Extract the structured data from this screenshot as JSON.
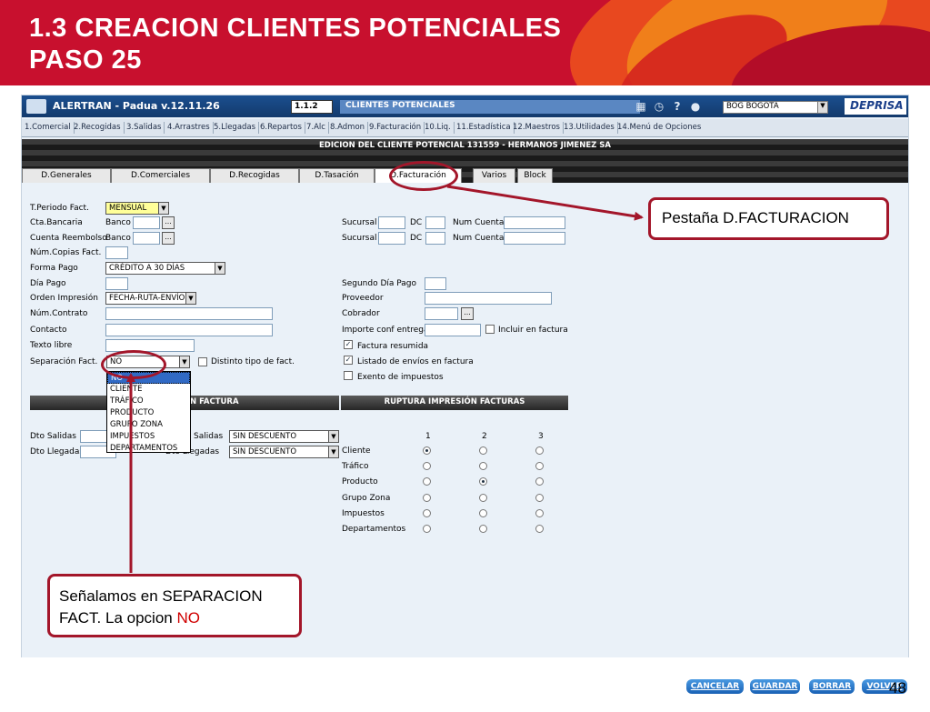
{
  "slide": {
    "title_line1": "1.3 CREACION CLIENTES POTENCIALES",
    "title_line2": "PASO 25",
    "page_number": "48"
  },
  "titlebar": {
    "app_name": "ALERTRAN - Padua  v.12.11.26",
    "module_code": "1.1.2",
    "module_name": "CLIENTES POTENCIALES",
    "office": "BOG BOGOTA",
    "brand": "DEPRISA",
    "icons": [
      "calendar-icon",
      "clock-icon",
      "help-icon",
      "user-icon"
    ]
  },
  "menu": [
    "1.Comercial",
    "2.Recogidas",
    "3.Salidas",
    "4.Arrastres",
    "5.Llegadas",
    "6.Repartos",
    "7.Alc",
    "8.Admon",
    "9.Facturación",
    "10.Liq.",
    "11.Estadística",
    "12.Maestros",
    "13.Utilidades",
    "14.Menú de Opciones"
  ],
  "edit_caption": "EDICION DEL CLIENTE POTENCIAL 131559 - HERMANOS JIMENEZ SA",
  "tabs": [
    "D.Generales",
    "D.Comerciales",
    "D.Recogidas",
    "D.Tasación",
    "D.Facturación",
    "Varios",
    "Block"
  ],
  "active_tab": "D.Facturación",
  "form_left": {
    "periodo_label": "T.Periodo Fact.",
    "periodo_value": "MENSUAL",
    "cta_bancaria_label": "Cta.Bancaria",
    "cuenta_reembolso_label": "Cuenta Reembolso",
    "banco_label": "Banco",
    "copias_label": "Núm.Copias Fact.",
    "forma_pago_label": "Forma Pago",
    "forma_pago_value": "CRÉDITO A 30 DÍAS",
    "dia_pago_label": "Día Pago",
    "orden_impresion_label": "Orden Impresión",
    "orden_impresion_value": "FECHA-RUTA-ENVÍO",
    "contrato_label": "Núm.Contrato",
    "contacto_label": "Contacto",
    "texto_libre_label": "Texto libre",
    "separacion_label": "Separación Fact.",
    "separacion_value": "NO",
    "distinto_label": "Distinto tipo de fact."
  },
  "form_right": {
    "sucursal_label": "Sucursal",
    "dc_label": "DC",
    "num_cuenta_label": "Num Cuenta",
    "segundo_dia_label": "Segundo Día Pago",
    "proveedor_label": "Proveedor",
    "cobrador_label": "Cobrador",
    "importe_label": "Importe conf entrega",
    "incluir_label": "Incluir en factura",
    "resumida_label": "Factura resumida",
    "listado_label": "Listado de envíos en factura",
    "exento_label": "Exento de impuestos"
  },
  "separacion_options": [
    "NO",
    "CLIENTE",
    "TRÁFICO",
    "PRODUCTO",
    "GRUPO ZONA",
    "IMPUESTOS",
    "DEPARTAMENTOS"
  ],
  "lower_left": {
    "header": "N FACTURA",
    "dto_salidas_label": "Dto Salidas",
    "dto_llegadas_label": "Dto Llegadas",
    "salidas_label": "Salidas",
    "llegadas_label": "Dto Llegadas",
    "salidas_value": "SIN DESCUENTO",
    "llegadas_value": "SIN DESCUENTO"
  },
  "ruptura": {
    "header": "RUPTURA IMPRESIÓN FACTURAS",
    "columns": [
      "1",
      "2",
      "3"
    ],
    "rows": [
      {
        "label": "Cliente",
        "selected": 1
      },
      {
        "label": "Tráfico",
        "selected": 0
      },
      {
        "label": "Producto",
        "selected": 2
      },
      {
        "label": "Grupo Zona",
        "selected": 0
      },
      {
        "label": "Impuestos",
        "selected": 0
      },
      {
        "label": "Departamentos",
        "selected": 0
      }
    ]
  },
  "actions": [
    "CANCELAR",
    "GUARDAR",
    "BORRAR",
    "VOLVER"
  ],
  "callouts": {
    "tab_note": "Pestaña D.FACTURACION",
    "note_line1": "Señalamos en SEPARACION",
    "note_line2_prefix": "FACT. La opcion ",
    "note_line2_highlight": "NO"
  },
  "colors": {
    "header_red": "#c8102e",
    "callout_border": "#a3162a",
    "highlight_text": "#d00000",
    "button_blue": "#1861b5"
  }
}
